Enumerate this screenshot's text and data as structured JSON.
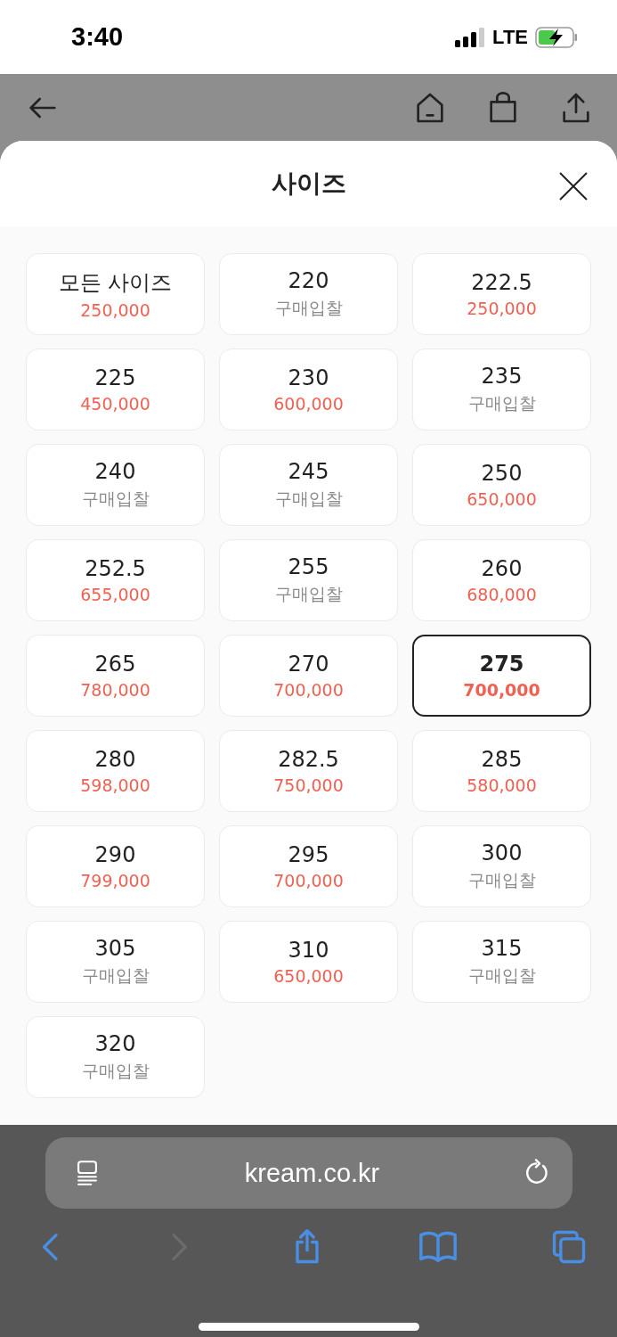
{
  "status_bar": {
    "time": "3:40",
    "network": "LTE"
  },
  "sheet": {
    "title": "사이즈"
  },
  "sizes": [
    {
      "size": "모든 사이즈",
      "price": "250,000",
      "kind": "price",
      "selected": false
    },
    {
      "size": "220",
      "price": "구매입찰",
      "kind": "bid",
      "selected": false
    },
    {
      "size": "222.5",
      "price": "250,000",
      "kind": "price",
      "selected": false
    },
    {
      "size": "225",
      "price": "450,000",
      "kind": "price",
      "selected": false
    },
    {
      "size": "230",
      "price": "600,000",
      "kind": "price",
      "selected": false
    },
    {
      "size": "235",
      "price": "구매입찰",
      "kind": "bid",
      "selected": false
    },
    {
      "size": "240",
      "price": "구매입찰",
      "kind": "bid",
      "selected": false
    },
    {
      "size": "245",
      "price": "구매입찰",
      "kind": "bid",
      "selected": false
    },
    {
      "size": "250",
      "price": "650,000",
      "kind": "price",
      "selected": false
    },
    {
      "size": "252.5",
      "price": "655,000",
      "kind": "price",
      "selected": false
    },
    {
      "size": "255",
      "price": "구매입찰",
      "kind": "bid",
      "selected": false
    },
    {
      "size": "260",
      "price": "680,000",
      "kind": "price",
      "selected": false
    },
    {
      "size": "265",
      "price": "780,000",
      "kind": "price",
      "selected": false
    },
    {
      "size": "270",
      "price": "700,000",
      "kind": "price",
      "selected": false
    },
    {
      "size": "275",
      "price": "700,000",
      "kind": "price",
      "selected": true
    },
    {
      "size": "280",
      "price": "598,000",
      "kind": "price",
      "selected": false
    },
    {
      "size": "282.5",
      "price": "750,000",
      "kind": "price",
      "selected": false
    },
    {
      "size": "285",
      "price": "580,000",
      "kind": "price",
      "selected": false
    },
    {
      "size": "290",
      "price": "799,000",
      "kind": "price",
      "selected": false
    },
    {
      "size": "295",
      "price": "700,000",
      "kind": "price",
      "selected": false
    },
    {
      "size": "300",
      "price": "구매입찰",
      "kind": "bid",
      "selected": false
    },
    {
      "size": "305",
      "price": "구매입찰",
      "kind": "bid",
      "selected": false
    },
    {
      "size": "310",
      "price": "650,000",
      "kind": "price",
      "selected": false
    },
    {
      "size": "315",
      "price": "구매입찰",
      "kind": "bid",
      "selected": false
    },
    {
      "size": "320",
      "price": "구매입찰",
      "kind": "bid",
      "selected": false
    }
  ],
  "browser": {
    "url": "kream.co.kr",
    "forward_disabled": true
  }
}
